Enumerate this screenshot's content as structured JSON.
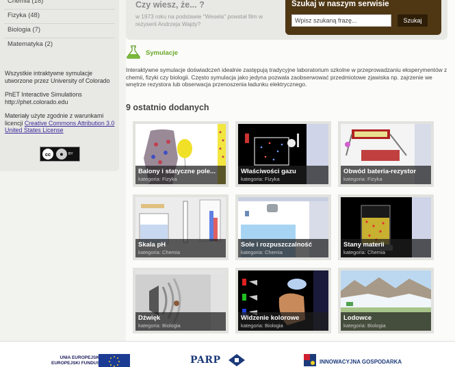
{
  "sidebar": {
    "categories": [
      {
        "label": "Chemia (18)"
      },
      {
        "label": "Fizyka (48)"
      },
      {
        "label": "Biologia (7)"
      },
      {
        "label": "Matematyka (2)"
      }
    ],
    "credits": {
      "simulations_note": "Wszystkie intraktywne symulacje utworzone przez University of Colorado",
      "phet_line1": "PhET Interactive Simulations",
      "phet_line2": "http://phet.colorado.edu",
      "license_text": "Materiały użyte zgodnie z warunkami licencji",
      "license_link": "Creative Commons Attribution 3.0 United States License",
      "cc_badge_cc": "cc",
      "cc_badge_by": "BY"
    }
  },
  "did_you_know": {
    "title": "Czy wiesz, że... ?",
    "text": "w 1973 roku na podstawie \"Wesela\" powstał film w reżyserii Andrzeja Wajdy?"
  },
  "search": {
    "title": "Szukaj w naszym serwisie",
    "placeholder": "Wpisz szukaną frazę...",
    "button_label": "Szukaj"
  },
  "simulations": {
    "title": "Symulacje",
    "intro": "Interaktywne symulacje doświadczeń idealnie zastępują tradycyjne laboratorium szkolne w przeprowadzaniu eksperymentów z chemii, fizyki czy biologii. Często symulacja jako jedyna pozwala zaobserwować przedmiotowe zjawiska np. zajrzenie we wnętrze rezystora lub obserwacja przenoszenia ładunku elektrycznego."
  },
  "recent": {
    "title": "9 ostatnio dodanych",
    "items": [
      {
        "title": "Balony i statyczne pole...",
        "category": "kategoria: Fizyka"
      },
      {
        "title": "Właściwości gazu",
        "category": "kategoria: Fizyka"
      },
      {
        "title": "Obwód bateria-rezystor",
        "category": "kategoria: Fizyka"
      },
      {
        "title": "Skala pH",
        "category": "kategoria: Chemia"
      },
      {
        "title": "Sole i rozpuszczalność",
        "category": "kategoria: Chemia"
      },
      {
        "title": "Stany materii",
        "category": "kategoria: Chemia"
      },
      {
        "title": "Dźwięk",
        "category": "kategoria: Biologia"
      },
      {
        "title": "Widzenie kolorowe",
        "category": "kategoria: Biologia"
      },
      {
        "title": "Lodowce",
        "category": "kategoria: Biologia"
      }
    ]
  },
  "footer": {
    "eu_line1": "UNIA EUROPEJSKA",
    "eu_line2": "EUROPEJSKI FUNDUSZ",
    "parp": "PARP",
    "innovation": "INNOWACYJNA GOSPODARKA"
  },
  "colors": {
    "accent_green": "#6aa82a",
    "search_panel": "#4f3714",
    "link": "#3a2a9a"
  }
}
